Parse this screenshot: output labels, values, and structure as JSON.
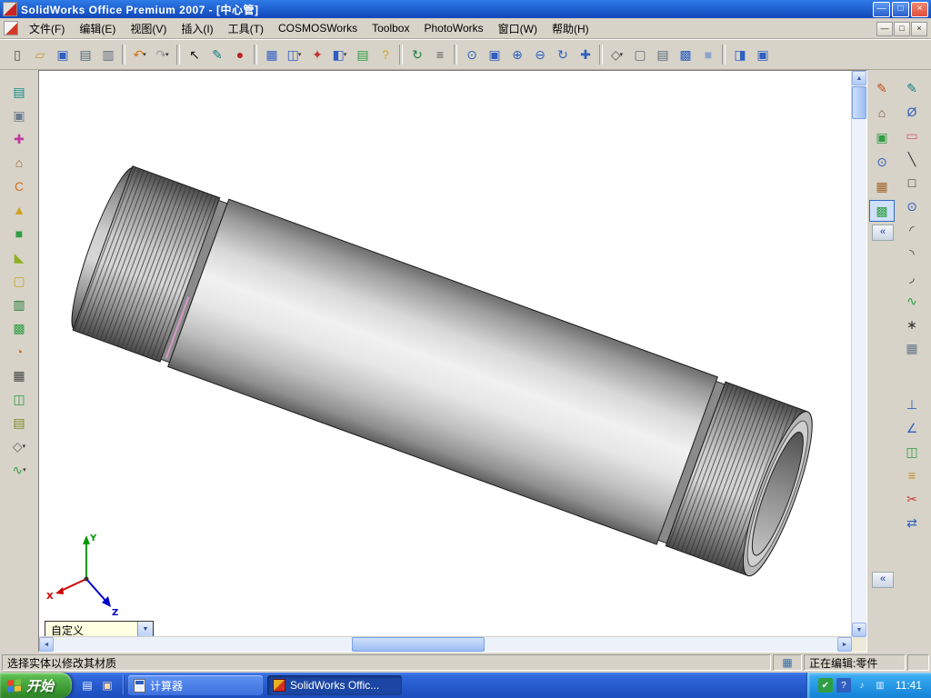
{
  "colors": {
    "c-title1": "#2E7BE8",
    "c-title2": "#1247B8",
    "c-close": "#DE5040",
    "c-menubg": "#D7D3C8",
    "c-toolbg": "#D7D3C8",
    "c-vpbg": "#FFFFFF",
    "c-task1": "#3168DC",
    "c-task2": "#1D4FBE",
    "c-start1": "#57B84C",
    "c-start2": "#2E8526",
    "c-tray1": "#35A8F0",
    "c-tray2": "#1584D8",
    "c-accent": "#316AC5",
    "c-pipe-light": "#F0F0F0",
    "c-pipe-dark": "#606060"
  },
  "title_bar": {
    "title": "SolidWorks Office Premium 2007 - [中心管]",
    "minimize": "—",
    "restore": "□",
    "close": "×"
  },
  "menu_bar": {
    "items": [
      {
        "label": "文件(F)"
      },
      {
        "label": "编辑(E)"
      },
      {
        "label": "视图(V)"
      },
      {
        "label": "插入(I)"
      },
      {
        "label": "工具(T)"
      },
      {
        "label": "COSMOSWorks"
      },
      {
        "label": "Toolbox"
      },
      {
        "label": "PhotoWorks"
      },
      {
        "label": "窗口(W)"
      },
      {
        "label": "帮助(H)"
      }
    ],
    "child_minimize": "—",
    "child_restore": "□",
    "child_close": "×"
  },
  "toolbar": {
    "items": [
      {
        "name": "new-document-button",
        "g": "▯",
        "c": "#4a4a4a",
        "d": "",
        "i": "true",
        "cls": "tb"
      },
      {
        "name": "open-button",
        "g": "▱",
        "c": "#C89A3A",
        "d": "",
        "i": "true",
        "cls": "tb"
      },
      {
        "name": "save-button",
        "g": "▣",
        "c": "#2F5FC0",
        "d": "",
        "i": "true",
        "cls": "tb"
      },
      {
        "name": "print-button",
        "g": "▤",
        "c": "#5A6B7C",
        "d": "",
        "i": "true",
        "cls": "tb"
      },
      {
        "name": "make-drawing-button",
        "g": "▥",
        "c": "#5A6B7C",
        "d": "",
        "i": "true",
        "cls": "tb"
      },
      {
        "name": "separator",
        "g": "",
        "c": "",
        "d": "",
        "i": "false",
        "cls": "tbsep"
      },
      {
        "name": "undo-button",
        "g": "↶",
        "c": "#D07820",
        "d": "▾",
        "i": "true",
        "cls": "tb"
      },
      {
        "name": "redo-button",
        "g": "↷",
        "c": "#9A9A9A",
        "d": "▾",
        "i": "true",
        "cls": "tb"
      },
      {
        "name": "separator",
        "g": "",
        "c": "",
        "d": "",
        "i": "false",
        "cls": "tbsep"
      },
      {
        "name": "select-tool",
        "g": "↖",
        "c": "#101010",
        "d": "",
        "i": "true",
        "cls": "tb"
      },
      {
        "name": "sketch-button",
        "g": "✎",
        "c": "#108080",
        "d": "",
        "i": "true",
        "cls": "tb"
      },
      {
        "name": "select-point-button",
        "g": "●",
        "c": "#C02020",
        "d": "",
        "i": "true",
        "cls": "tb"
      },
      {
        "name": "separator",
        "g": "",
        "c": "",
        "d": "",
        "i": "false",
        "cls": "tbsep"
      },
      {
        "name": "design-table-button",
        "g": "▦",
        "c": "#2F5FC0",
        "d": "",
        "i": "true",
        "cls": "tb"
      },
      {
        "name": "view-palette-button",
        "g": "◫",
        "c": "#2F5FC0",
        "d": "▾",
        "i": "true",
        "cls": "tb"
      },
      {
        "name": "feature-flag-button",
        "g": "✦",
        "c": "#C03030",
        "d": "",
        "i": "true",
        "cls": "tb"
      },
      {
        "name": "split-window-button",
        "g": "◧",
        "c": "#2F5FC0",
        "d": "▾",
        "i": "true",
        "cls": "tb"
      },
      {
        "name": "design-journal-button",
        "g": "▤",
        "c": "#2F9E44",
        "d": "",
        "i": "true",
        "cls": "tb"
      },
      {
        "name": "help-button",
        "g": "?",
        "c": "#D9A520",
        "d": "",
        "i": "true",
        "cls": "tb"
      },
      {
        "name": "separator",
        "g": "",
        "c": "",
        "d": "",
        "i": "false",
        "cls": "tbsep"
      },
      {
        "name": "rebuild-button",
        "g": "↻",
        "c": "#208040",
        "d": "",
        "i": "true",
        "cls": "tb"
      },
      {
        "name": "options-button",
        "g": "≡",
        "c": "#555555",
        "d": "",
        "i": "true",
        "cls": "tb"
      },
      {
        "name": "separator",
        "g": "",
        "c": "",
        "d": "",
        "i": "false",
        "cls": "tbsep"
      },
      {
        "name": "zoom-fit-button",
        "g": "⊙",
        "c": "#2F5FC0",
        "d": "",
        "i": "true",
        "cls": "tb"
      },
      {
        "name": "zoom-area-button",
        "g": "▣",
        "c": "#2F5FC0",
        "d": "",
        "i": "true",
        "cls": "tb"
      },
      {
        "name": "zoom-in-button",
        "g": "⊕",
        "c": "#2F5FC0",
        "d": "",
        "i": "true",
        "cls": "tb"
      },
      {
        "name": "zoom-out-button",
        "g": "⊖",
        "c": "#2F5FC0",
        "d": "",
        "i": "true",
        "cls": "tb"
      },
      {
        "name": "rotate-view-button",
        "g": "↻",
        "c": "#2F5FC0",
        "d": "",
        "i": "true",
        "cls": "tb"
      },
      {
        "name": "pan-button",
        "g": "✚",
        "c": "#2F5FC0",
        "d": "",
        "i": "true",
        "cls": "tb"
      },
      {
        "name": "separator",
        "g": "",
        "c": "",
        "d": "",
        "i": "false",
        "cls": "tbsep"
      },
      {
        "name": "view-orientation-button",
        "g": "◇",
        "c": "#555555",
        "d": "▾",
        "i": "true",
        "cls": "tb"
      },
      {
        "name": "wireframe-button",
        "g": "▢",
        "c": "#5A6B7C",
        "d": "",
        "i": "true",
        "cls": "tb"
      },
      {
        "name": "hidden-lines-button",
        "g": "▤",
        "c": "#5A6B7C",
        "d": "",
        "i": "true",
        "cls": "tb"
      },
      {
        "name": "shaded-with-edges-button",
        "g": "▩",
        "c": "#2F5FC0",
        "d": "",
        "i": "true",
        "cls": "tb"
      },
      {
        "name": "shaded-button",
        "g": "■",
        "c": "#8FA4CC",
        "d": "",
        "i": "true",
        "cls": "tb"
      },
      {
        "name": "separator",
        "g": "",
        "c": "",
        "d": "",
        "i": "false",
        "cls": "tbsep"
      },
      {
        "name": "section-view-button",
        "g": "◨",
        "c": "#2F5FC0",
        "d": "",
        "i": "true",
        "cls": "tb"
      },
      {
        "name": "realview-button",
        "g": "▣",
        "c": "#2F5FC0",
        "d": "",
        "i": "true",
        "cls": "tb"
      }
    ]
  },
  "left_toolbar": {
    "items": [
      {
        "name": "extruded-boss-icon",
        "g": "▤",
        "c": "#0F8A8A",
        "d": "",
        "i": "true",
        "cls": "lt"
      },
      {
        "name": "revolved-boss-icon",
        "g": "▣",
        "c": "#6A7B8C",
        "d": "",
        "i": "true",
        "cls": "lt"
      },
      {
        "name": "move-face-icon",
        "g": "✚",
        "c": "#C23AA0",
        "d": "",
        "i": "true",
        "cls": "lt"
      },
      {
        "name": "dome-icon",
        "g": "⌂",
        "c": "#A2652A",
        "d": "",
        "i": "true",
        "cls": "lt"
      },
      {
        "name": "helix-icon",
        "g": "C",
        "c": "#D2701F",
        "d": "",
        "i": "true",
        "cls": "lt"
      },
      {
        "name": "draft-icon",
        "g": "▲",
        "c": "#D2A11F",
        "d": "",
        "i": "true",
        "cls": "lt"
      },
      {
        "name": "extruded-cut-icon",
        "g": "■",
        "c": "#2F9E44",
        "d": "",
        "i": "true",
        "cls": "lt"
      },
      {
        "name": "chamfer-icon",
        "g": "◣",
        "c": "#8FB024",
        "d": "",
        "i": "true",
        "cls": "lt"
      },
      {
        "name": "shell-icon",
        "g": "▢",
        "c": "#C9A227",
        "d": "",
        "i": "true",
        "cls": "lt"
      },
      {
        "name": "rib-icon",
        "g": "▥",
        "c": "#1F7A33",
        "d": "",
        "i": "true",
        "cls": "lt"
      },
      {
        "name": "wrap-icon",
        "g": "▩",
        "c": "#2F9E44",
        "d": "",
        "i": "true",
        "cls": "lt"
      },
      {
        "name": "circular-pattern-icon",
        "g": "◔",
        "c": "#D2701F",
        "d": "",
        "i": "true",
        "cls": "lt"
      },
      {
        "name": "linear-pattern-icon",
        "g": "▦",
        "c": "#444444",
        "d": "",
        "i": "true",
        "cls": "lt"
      },
      {
        "name": "mirror-feature-icon",
        "g": "◫",
        "c": "#2F9E44",
        "d": "",
        "i": "true",
        "cls": "lt"
      },
      {
        "name": "pattern-table-icon",
        "g": "▤",
        "c": "#7A8B2A",
        "d": "",
        "i": "true",
        "cls": "lt"
      },
      {
        "name": "measure-icon",
        "g": "◇",
        "c": "#666666",
        "d": "▾",
        "i": "true",
        "cls": "lt"
      },
      {
        "name": "curve-icon",
        "g": "∿",
        "c": "#2F9E44",
        "d": "▾",
        "i": "true",
        "cls": "lt"
      }
    ]
  },
  "right_toolbar": {
    "collapse": "«",
    "column_a": [
      {
        "name": "edit-sketch-icon",
        "g": "✎",
        "c": "#C05020",
        "i": "true",
        "cls": "rt"
      },
      {
        "name": "standard-views-icon",
        "g": "⌂",
        "c": "#7A5230",
        "i": "true",
        "cls": "rt"
      },
      {
        "name": "model-view-icon",
        "g": "▣",
        "c": "#2F9E44",
        "i": "true",
        "cls": "rt"
      },
      {
        "name": "magnifier-icon",
        "g": "⊙",
        "c": "#2F5FC0",
        "i": "true",
        "cls": "rt"
      },
      {
        "name": "appearance-icon",
        "g": "▦",
        "c": "#A2652A",
        "i": "true",
        "cls": "rt"
      },
      {
        "name": "scene-icon",
        "g": "▩",
        "c": "#2F9E44",
        "i": "true",
        "cls": "rt pressed"
      }
    ],
    "column_b_top": [
      {
        "name": "sketch-tool-icon",
        "g": "✎",
        "c": "#108080",
        "i": "true",
        "cls": "rt"
      },
      {
        "name": "smart-dimension-icon",
        "g": "Ø",
        "c": "#2F5FC0",
        "i": "true",
        "cls": "rt"
      },
      {
        "name": "erase-icon",
        "g": "▭",
        "c": "#E05080",
        "i": "true",
        "cls": "rt"
      },
      {
        "name": "line-icon",
        "g": "╲",
        "c": "#333333",
        "i": "true",
        "cls": "rt"
      },
      {
        "name": "rectangle-icon",
        "g": "□",
        "c": "#333333",
        "i": "true",
        "cls": "rt"
      },
      {
        "name": "circle-icon",
        "g": "⊙",
        "c": "#2F5FC0",
        "i": "true",
        "cls": "rt"
      },
      {
        "name": "centerpoint-arc-icon",
        "g": "◜",
        "c": "#333333",
        "i": "true",
        "cls": "rt"
      },
      {
        "name": "tangent-arc-icon",
        "g": "◝",
        "c": "#333333",
        "i": "true",
        "cls": "rt"
      },
      {
        "name": "three-point-arc-icon",
        "g": "◞",
        "c": "#333333",
        "i": "true",
        "cls": "rt"
      },
      {
        "name": "spline-icon",
        "g": "∿",
        "c": "#2F9E44",
        "i": "true",
        "cls": "rt"
      },
      {
        "name": "point-icon",
        "g": "∗",
        "c": "#333333",
        "i": "true",
        "cls": "rt"
      },
      {
        "name": "construction-geometry-icon",
        "g": "▦",
        "c": "#667788",
        "i": "true",
        "cls": "rt"
      }
    ],
    "column_b_bottom": [
      {
        "name": "add-relation-icon",
        "g": "⊥",
        "c": "#2F5FC0",
        "i": "true",
        "cls": "rt grp2"
      },
      {
        "name": "display-relations-icon",
        "g": "∠",
        "c": "#2F5FC0",
        "i": "true",
        "cls": "rt"
      },
      {
        "name": "mirror-entities-icon",
        "g": "◫",
        "c": "#2F9E44",
        "i": "true",
        "cls": "rt"
      },
      {
        "name": "offset-entities-icon",
        "g": "≡",
        "c": "#C28A1F",
        "i": "true",
        "cls": "rt"
      },
      {
        "name": "trim-entities-icon",
        "g": "✂",
        "c": "#C23A3A",
        "i": "true",
        "cls": "rt"
      },
      {
        "name": "convert-entities-icon",
        "g": "⇄",
        "c": "#2F5FC0",
        "i": "true",
        "cls": "rt"
      }
    ]
  },
  "viewport": {
    "model_name": "中心管",
    "combo_value": "自定义",
    "combo_arrow": "▼",
    "triad": {
      "x": "X",
      "y": "Y",
      "z": "Z"
    },
    "splitter": "◂▸"
  },
  "scrollbar": {
    "up": "▲",
    "down": "▼",
    "left": "◄",
    "right": "►"
  },
  "status_bar": {
    "message": "选择实体以修改其材质",
    "grid_icon": "▦",
    "editing": "正在编辑:零件"
  },
  "taskbar": {
    "start": "开始",
    "quick_launch": [
      {
        "name": "show-desktop-icon",
        "g": "▤",
        "c": "#EAF2FF"
      },
      {
        "name": "media-player-icon",
        "g": "▣",
        "c": "#FFD7A0"
      }
    ],
    "tasks": [
      {
        "label": "计算器"
      },
      {
        "label": "SolidWorks Offic..."
      }
    ],
    "tray_icons": [
      {
        "name": "antivirus-icon",
        "g": "✔",
        "c": "#FFFFFF",
        "bg": "#2F9E44"
      },
      {
        "name": "help-center-icon",
        "g": "?",
        "c": "#FFFFFF",
        "bg": "#2F5FC0"
      },
      {
        "name": "volume-icon",
        "g": "♪",
        "c": "#EAF2FF",
        "bg": ""
      },
      {
        "name": "network-icon",
        "g": "▥",
        "c": "#EAF2FF",
        "bg": ""
      }
    ],
    "time": "11:41"
  }
}
